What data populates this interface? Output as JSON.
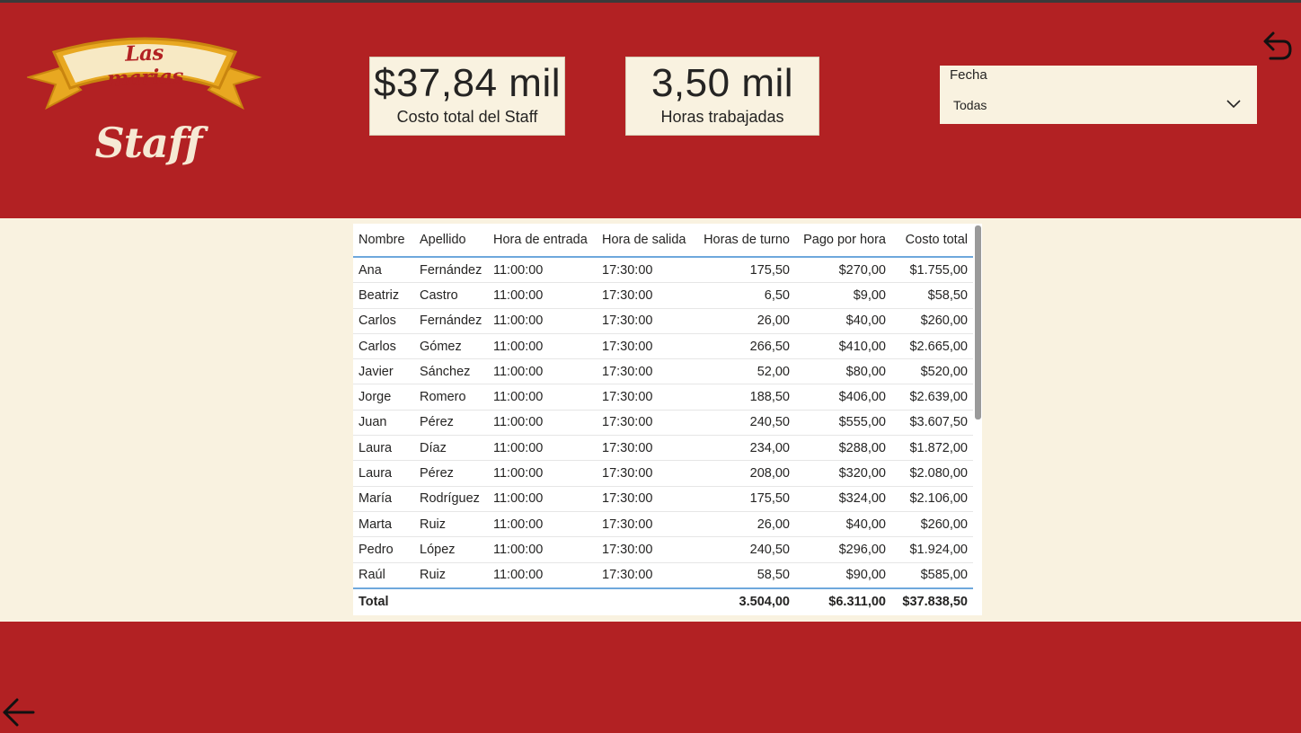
{
  "logo": {
    "banner_text": "Las marias",
    "subtitle": "Staff"
  },
  "kpis": [
    {
      "value": "$37,84 mil",
      "label": "Costo total del Staff"
    },
    {
      "value": "3,50 mil",
      "label": "Horas trabajadas"
    }
  ],
  "slicer": {
    "title": "Fecha",
    "selected": "Todas"
  },
  "table": {
    "columns": [
      "Nombre",
      "Apellido",
      "Hora de entrada",
      "Hora de salida",
      "Horas de turno",
      "Pago por hora",
      "Costo total"
    ],
    "rows": [
      [
        "Ana",
        "Fernández",
        "11:00:00",
        "17:30:00",
        "175,50",
        "$270,00",
        "$1.755,00"
      ],
      [
        "Beatriz",
        "Castro",
        "11:00:00",
        "17:30:00",
        "6,50",
        "$9,00",
        "$58,50"
      ],
      [
        "Carlos",
        "Fernández",
        "11:00:00",
        "17:30:00",
        "26,00",
        "$40,00",
        "$260,00"
      ],
      [
        "Carlos",
        "Gómez",
        "11:00:00",
        "17:30:00",
        "266,50",
        "$410,00",
        "$2.665,00"
      ],
      [
        "Javier",
        "Sánchez",
        "11:00:00",
        "17:30:00",
        "52,00",
        "$80,00",
        "$520,00"
      ],
      [
        "Jorge",
        "Romero",
        "11:00:00",
        "17:30:00",
        "188,50",
        "$406,00",
        "$2.639,00"
      ],
      [
        "Juan",
        "Pérez",
        "11:00:00",
        "17:30:00",
        "240,50",
        "$555,00",
        "$3.607,50"
      ],
      [
        "Laura",
        "Díaz",
        "11:00:00",
        "17:30:00",
        "234,00",
        "$288,00",
        "$1.872,00"
      ],
      [
        "Laura",
        "Pérez",
        "11:00:00",
        "17:30:00",
        "208,00",
        "$320,00",
        "$2.080,00"
      ],
      [
        "María",
        "Rodríguez",
        "11:00:00",
        "17:30:00",
        "175,50",
        "$324,00",
        "$2.106,00"
      ],
      [
        "Marta",
        "Ruiz",
        "11:00:00",
        "17:30:00",
        "26,00",
        "$40,00",
        "$260,00"
      ],
      [
        "Pedro",
        "López",
        "11:00:00",
        "17:30:00",
        "240,50",
        "$296,00",
        "$1.924,00"
      ],
      [
        "Raúl",
        "Ruiz",
        "11:00:00",
        "17:30:00",
        "58,50",
        "$90,00",
        "$585,00"
      ]
    ],
    "total": {
      "label": "Total",
      "horas": "3.504,00",
      "pago": "$6.311,00",
      "costo": "$37.838,50"
    }
  },
  "colors": {
    "brand_red": "#b22123",
    "cream": "#f9f2e0",
    "banner_gold": "#e8a821",
    "accent_blue": "#6ea8dc"
  },
  "icons": {
    "top_right": "undo-icon",
    "bottom_left": "back-arrow-icon",
    "slicer": "chevron-down-icon"
  }
}
